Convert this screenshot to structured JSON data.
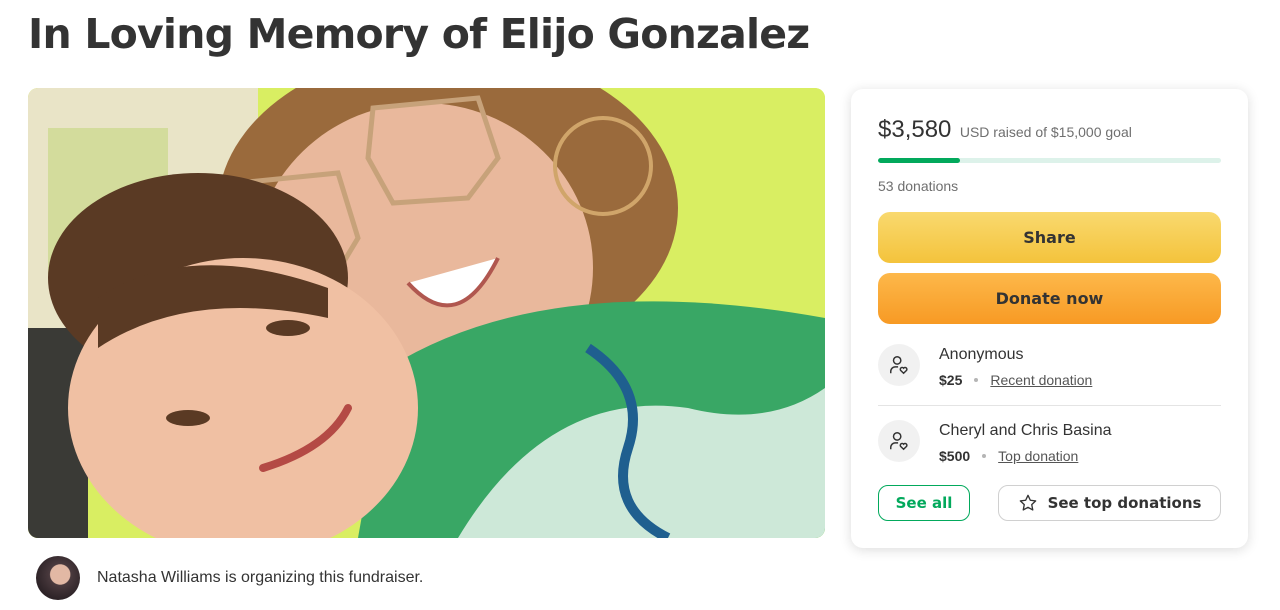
{
  "page": {
    "title": "In Loving Memory of Elijo Gonzalez"
  },
  "organizer": {
    "text": "Natasha Williams is organizing this fundraiser."
  },
  "donation_card": {
    "raised_amount": "$3,580",
    "raised_text": "USD raised of $15,000 goal",
    "progress_fraction": 0.239,
    "donation_count": "53 donations",
    "share_label": "Share",
    "donate_label": "Donate now",
    "donors": [
      {
        "name": "Anonymous",
        "amount": "$25",
        "tag": "Recent donation",
        "icon": "donor-heart-icon"
      },
      {
        "name": "Cheryl and Chris Basina",
        "amount": "$500",
        "tag": "Top donation",
        "icon": "donor-heart-icon"
      }
    ],
    "see_all_label": "See all",
    "see_top_label": "See top donations"
  },
  "colors": {
    "brand_green": "#02a95c",
    "share_yellow": "#f4c33c",
    "donate_orange": "#f79a24",
    "text_dark": "#333333"
  },
  "icons": {
    "donor": "donor-heart-icon",
    "star": "star-icon"
  }
}
